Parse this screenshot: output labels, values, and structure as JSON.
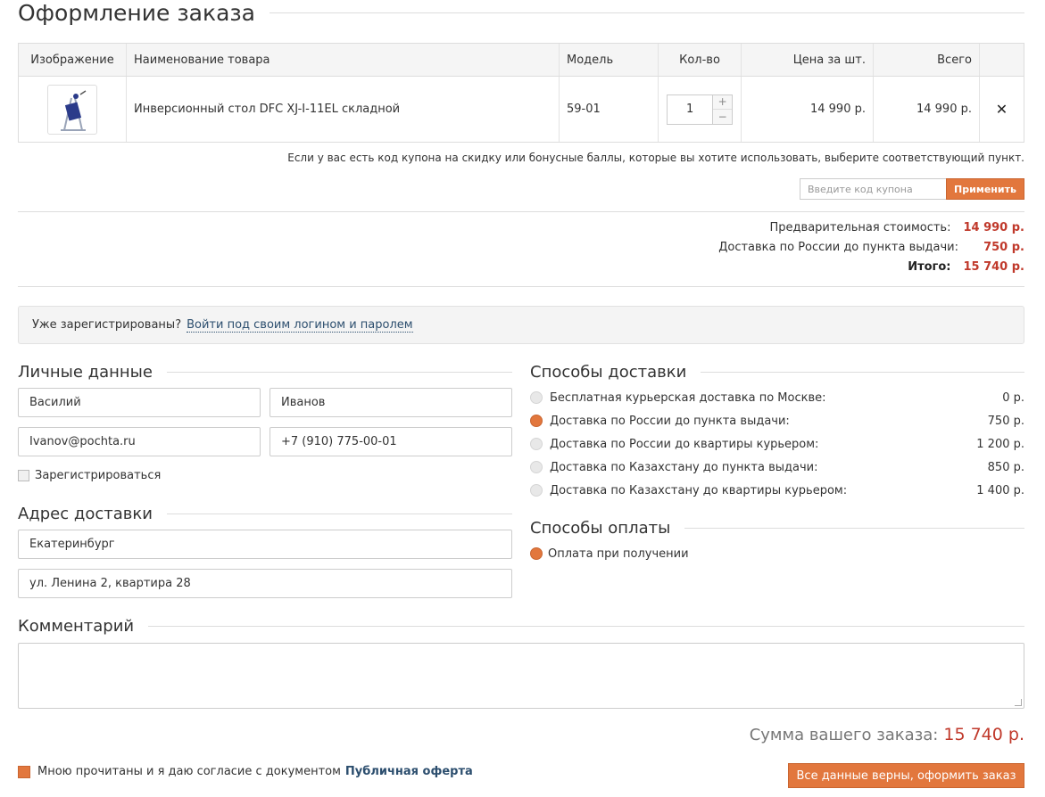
{
  "page": {
    "title": "Оформление заказа"
  },
  "cart": {
    "headers": {
      "image": "Изображение",
      "name": "Наименование товара",
      "model": "Модель",
      "qty": "Кол-во",
      "unit_price": "Цена за шт.",
      "total": "Всего"
    },
    "items": [
      {
        "name": "Инверсионный стол DFC XJ-I-11EL складной",
        "model": "59-01",
        "qty": "1",
        "unit_price": "14 990 р.",
        "total": "14 990 р.",
        "remove_icon": "close-icon"
      }
    ],
    "qty_plus": "+",
    "qty_minus": "−",
    "remove_glyph": "✕"
  },
  "coupon": {
    "hint": "Если у вас есть код купона на скидку или бонусные баллы, которые вы хотите использовать, выберите соответствующий пункт.",
    "placeholder": "Введите код купона",
    "apply_label": "Применить"
  },
  "totals": {
    "subtotal_label": "Предварительная стоимость:",
    "subtotal_value": "14 990 р.",
    "delivery_label": "Доставка по России до пункта выдачи:",
    "delivery_value": "750 р.",
    "total_label": "Итого:",
    "total_value": "15 740 р."
  },
  "login": {
    "prompt": "Уже зарегистрированы?",
    "link": "Войти под своим логином и паролем"
  },
  "personal": {
    "heading": "Личные данные",
    "first_name": "Василий",
    "last_name": "Иванов",
    "email": "Ivanov@pochta.ru",
    "phone": "+7 (910) 775-00-01",
    "register_label": "Зарегистрироваться"
  },
  "address": {
    "heading": "Адрес доставки",
    "city": "Екатеринбург",
    "street": "ул. Ленина 2, квартира 28"
  },
  "delivery": {
    "heading": "Способы доставки",
    "options": [
      {
        "label": "Бесплатная курьерская доставка по Москве:",
        "price": "0 р.",
        "selected": false
      },
      {
        "label": "Доставка по России до пункта выдачи:",
        "price": "750 р.",
        "selected": true
      },
      {
        "label": "Доставка по России до квартиры курьером:",
        "price": "1 200 р.",
        "selected": false
      },
      {
        "label": "Доставка по Казахстану до пункта выдачи:",
        "price": "850 р.",
        "selected": false
      },
      {
        "label": "Доставка по Казахстану до квартиры курьером:",
        "price": "1 400 р.",
        "selected": false
      }
    ]
  },
  "payment": {
    "heading": "Способы оплаты",
    "options": [
      {
        "label": "Оплата при получении",
        "selected": true
      }
    ]
  },
  "comment": {
    "heading": "Комментарий",
    "value": ""
  },
  "summary": {
    "label": "Сумма вашего заказа:",
    "value": "15 740 р."
  },
  "agreement": {
    "text": "Мною прочитаны и я даю согласие с документом",
    "link": "Публичная оферта"
  },
  "submit": {
    "label": "Все данные верны, оформить заказ"
  },
  "colors": {
    "accent": "#e2773d",
    "price_red": "#c0392b",
    "link": "#2c4e6e"
  }
}
